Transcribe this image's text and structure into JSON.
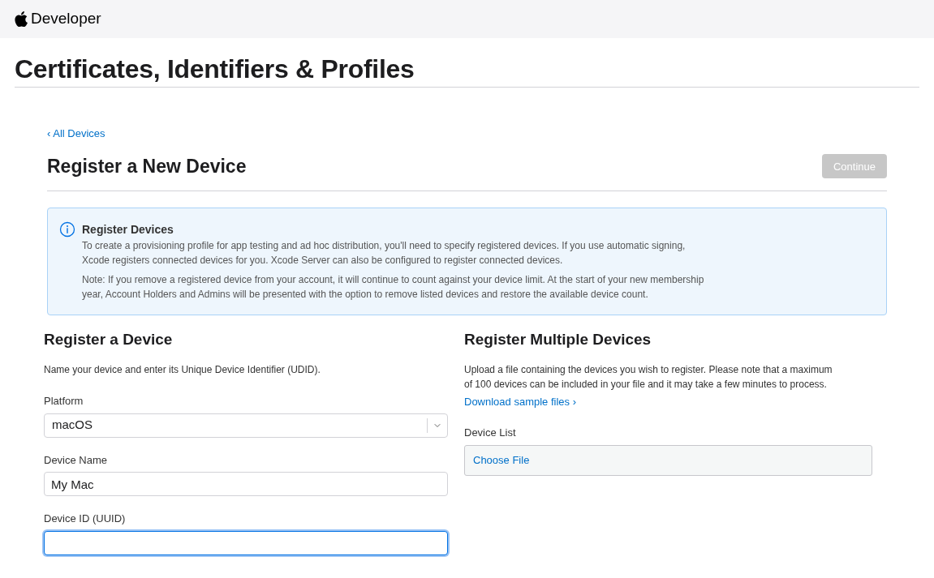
{
  "header": {
    "brand": "Developer"
  },
  "page_title": "Certificates, Identifiers & Profiles",
  "back_link": "‹ All Devices",
  "heading": "Register a New Device",
  "continue_button": {
    "label": "Continue",
    "disabled": true
  },
  "notice": {
    "title": "Register Devices",
    "paragraphs": [
      "To create a provisioning profile for app testing and ad hoc distribution, you'll need to specify registered devices. If you use automatic signing, Xcode registers connected devices for you. Xcode Server can also be configured to register connected devices.",
      "Note: If you remove a registered device from your account, it will continue to count against your device limit. At the start of your new membership year, Account Holders and Admins will be presented with the option to remove listed devices and restore the available device count."
    ]
  },
  "single": {
    "title": "Register a Device",
    "intro": "Name your device and enter its Unique Device Identifier (UDID).",
    "fields": [
      {
        "kind": "select",
        "label": "Platform",
        "value": "macOS",
        "focused": false
      },
      {
        "kind": "text",
        "label": "Device Name",
        "value": "My Mac",
        "focused": false
      },
      {
        "kind": "text",
        "label": "Device ID (UUID)",
        "focused": true
      }
    ]
  },
  "multiple": {
    "title": "Register Multiple Devices",
    "intro": "Upload a file containing the devices you wish to register. Please note that a maximum of 100 devices can be included in your file and it may take a few minutes to process.",
    "link": "Download sample files ›",
    "file_label": "Device List",
    "file_button": "Choose File"
  }
}
